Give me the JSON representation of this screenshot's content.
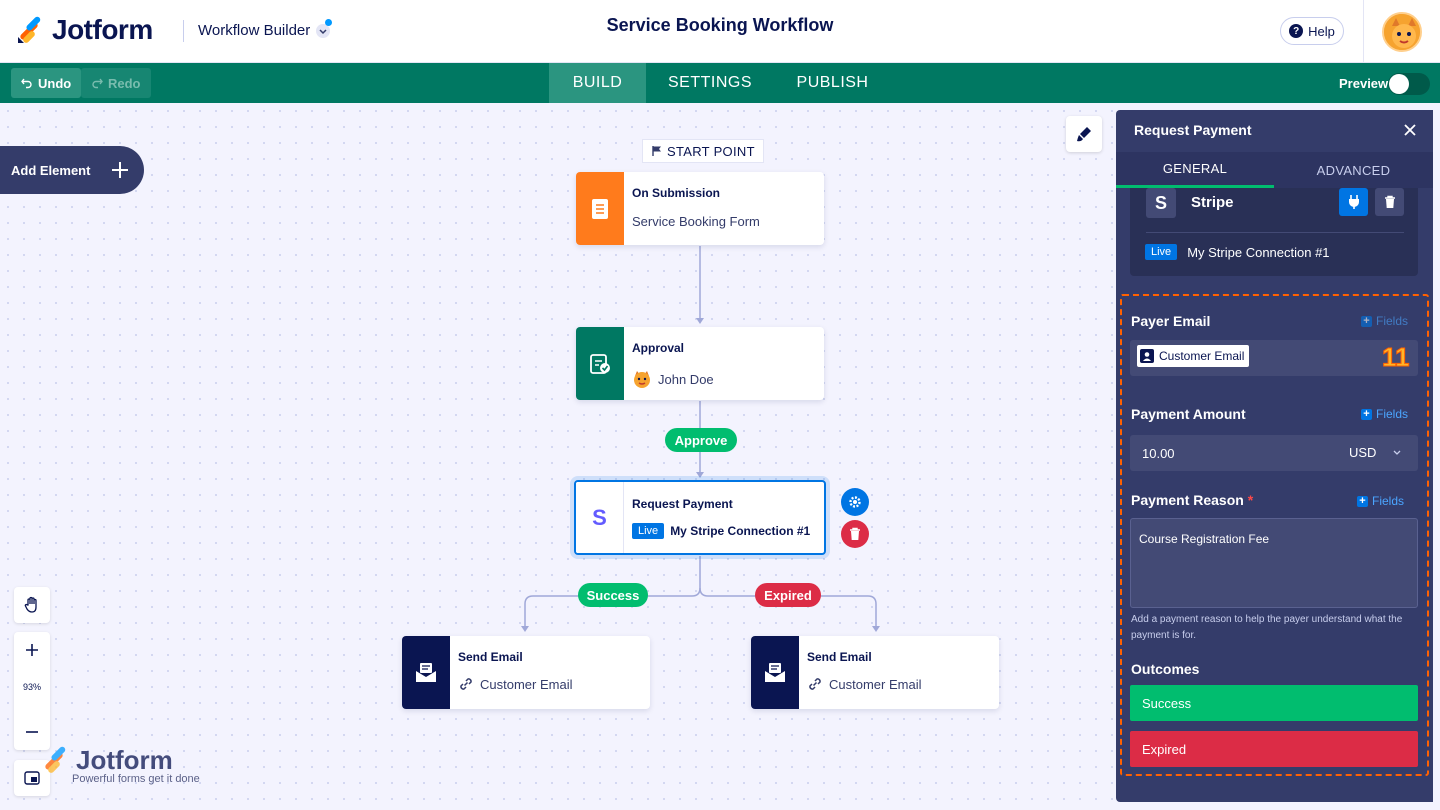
{
  "header": {
    "logo_text": "Jotform",
    "app_label": "Workflow Builder",
    "page_title": "Service Booking Workflow",
    "help_label": "Help"
  },
  "toolbar": {
    "undo_label": "Undo",
    "redo_label": "Redo",
    "tabs": [
      {
        "label": "BUILD",
        "active": true
      },
      {
        "label": "SETTINGS",
        "active": false
      },
      {
        "label": "PUBLISH",
        "active": false
      }
    ],
    "preview_label": "Preview",
    "preview_on": false
  },
  "canvas": {
    "add_element_label": "Add Element",
    "start_label": "START POINT",
    "zoom": "93%",
    "nodes": {
      "submission": {
        "title": "On Submission",
        "subtitle": "Service Booking Form",
        "color": "#ff7b1c"
      },
      "approval": {
        "title": "Approval",
        "subtitle": "John Doe",
        "color": "#007862"
      },
      "payment": {
        "title": "Request Payment",
        "badge": "Live",
        "subtitle": "My Stripe Connection #1"
      },
      "email_success": {
        "title": "Send Email",
        "subtitle": "Customer Email",
        "color": "#0a1551"
      },
      "email_expired": {
        "title": "Send Email",
        "subtitle": "Customer Email",
        "color": "#0a1551"
      }
    },
    "branches": {
      "approve": "Approve",
      "success": "Success",
      "expired": "Expired"
    },
    "watermark": {
      "name": "Jotform",
      "tagline": "Powerful forms get it done"
    }
  },
  "panel": {
    "title": "Request Payment",
    "tabs": [
      {
        "label": "GENERAL",
        "active": true
      },
      {
        "label": "ADVANCED",
        "active": false
      }
    ],
    "gateway": {
      "logo": "S",
      "name": "Stripe",
      "badge": "Live",
      "connection": "My Stripe Connection #1"
    },
    "payer_email": {
      "label": "Payer Email",
      "fields_label": "Fields",
      "chip": "Customer Email"
    },
    "step_number": "11",
    "amount": {
      "label": "Payment Amount",
      "fields_label": "Fields",
      "value": "10.00",
      "currency": "USD"
    },
    "reason": {
      "label": "Payment Reason",
      "required": "*",
      "fields_label": "Fields",
      "value": "Course Registration Fee",
      "help": "Add a payment reason to help the payer understand what the payment is for."
    },
    "outcomes": {
      "label": "Outcomes",
      "items": [
        {
          "label": "Success",
          "color": "#01bd6f"
        },
        {
          "label": "Expired",
          "color": "#dc2c46"
        }
      ]
    }
  }
}
